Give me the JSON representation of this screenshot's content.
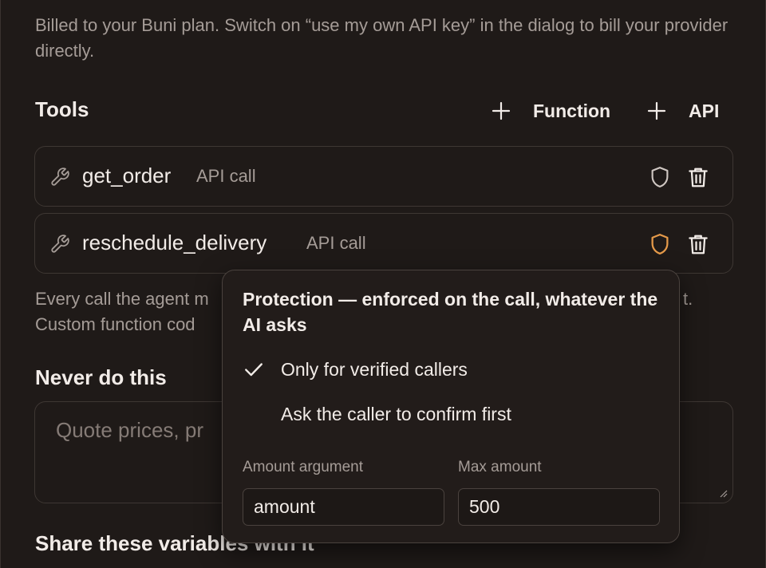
{
  "billing_note": "Billed to your Buni plan. Switch on “use my own API key” in the dialog to bill your provider directly.",
  "tools": {
    "heading": "Tools",
    "add_function_label": "Function",
    "add_api_label": "API",
    "items": [
      {
        "name": "get_order",
        "kind": "API call",
        "protected": false
      },
      {
        "name": "reschedule_delivery",
        "kind": "API call",
        "protected": true
      }
    ]
  },
  "tools_note_line1": "Every call the agent m",
  "tools_note_line1_end": "t.",
  "tools_note_line2": "Custom function cod",
  "never": {
    "heading": "Never do this",
    "placeholder": "Quote prices, pr"
  },
  "share_heading": "Share these variables with it",
  "protection_popover": {
    "title": "Protection — enforced on the call, whatever the AI asks",
    "options": [
      {
        "label": "Only for verified callers",
        "checked": true
      },
      {
        "label": "Ask the caller to confirm first",
        "checked": false
      }
    ],
    "amount_argument_label": "Amount argument",
    "amount_argument_value": "amount",
    "max_amount_label": "Max amount",
    "max_amount_value": "500"
  },
  "colors": {
    "background": "#1f1a18",
    "text": "#f2ece8",
    "muted": "#a59c97",
    "protected_shield": "#e59a4a",
    "border": "#3e3733"
  }
}
